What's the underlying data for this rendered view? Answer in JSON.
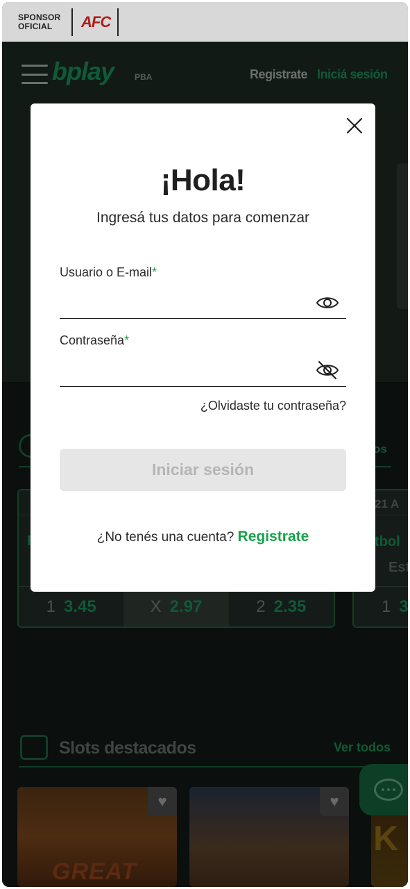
{
  "sponsor": {
    "label": "SPONSOR OFICIAL",
    "brand": "AFC"
  },
  "header": {
    "logo": "bplay",
    "logo_suffix": "PBA",
    "register_label": "Registrate",
    "login_label": "Iniciá sesión"
  },
  "background": {
    "sport_link": "os",
    "match_card_left": "F",
    "match_card_date": "21 A",
    "match_card_sport": "tbol",
    "match_card_team": "Est",
    "odds": [
      {
        "key": "1",
        "value": "3.45"
      },
      {
        "key": "X",
        "value": "2.97"
      },
      {
        "key": "2",
        "value": "2.35"
      }
    ],
    "odds_partial": {
      "key": "1",
      "value": "3"
    },
    "slots_title": "Slots destacados",
    "slots_link": "Ver todos",
    "slot_word": "GREAT",
    "slot3_letter": "K"
  },
  "modal": {
    "title": "¡Hola!",
    "subtitle": "Ingresá tus datos para comenzar",
    "username_label": "Usuario o E-mail",
    "username_value": "",
    "password_label": "Contraseña",
    "password_value": "",
    "required_mark": "*",
    "forgot_link": "¿Olvidaste tu contraseña?",
    "submit_label": "Iniciar sesión",
    "no_account_text": "¿No tenés una cuenta?",
    "register_link": "Registrate"
  },
  "colors": {
    "accent": "#17a34a",
    "overlay_bg": "#0d1411",
    "button_disabled": "#e6e6e6"
  },
  "icons": {
    "close": "close-icon",
    "show_password": "eye-icon",
    "hide_password": "eye-off-icon",
    "favorite": "heart-icon",
    "chat": "chat-icon"
  }
}
